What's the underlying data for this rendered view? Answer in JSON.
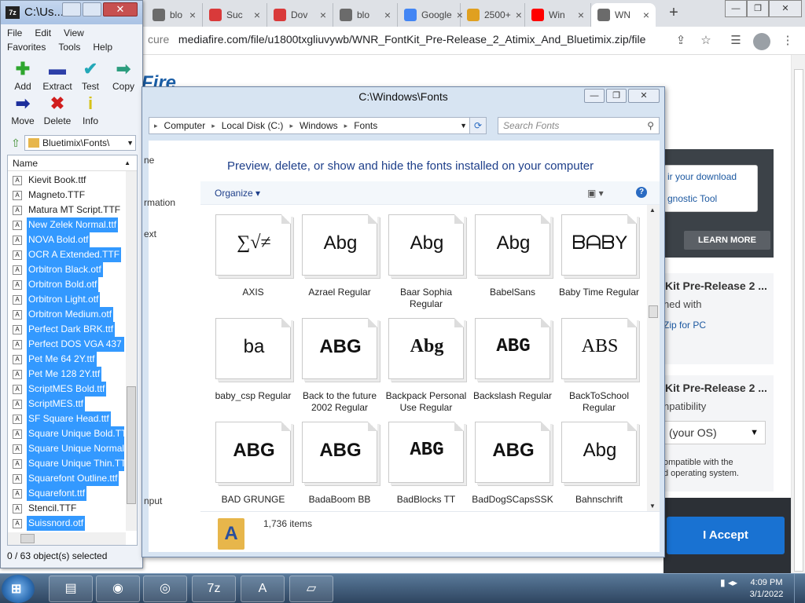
{
  "chrome": {
    "tabs": [
      {
        "label": "blo",
        "favicon_color": "#6b6b6b"
      },
      {
        "label": "Suc",
        "favicon_color": "#d93a3a"
      },
      {
        "label": "Dov",
        "favicon_color": "#d93a3a"
      },
      {
        "label": "blo",
        "favicon_color": "#6b6b6b"
      },
      {
        "label": "Google",
        "favicon_color": "#4285f4"
      },
      {
        "label": "2500+",
        "favicon_color": "#e0a020"
      },
      {
        "label": "Win",
        "favicon_color": "#ff0000"
      },
      {
        "label": "WN",
        "favicon_color": "#6b6b6b"
      }
    ],
    "tab_close": "×",
    "new_tab": "+",
    "url_scheme": "cure",
    "url": "mediafire.com/file/u1800txgliuvywb/WNR_FontKit_Pre-Release_2_Atimix_And_Bluetimix.zip/file"
  },
  "page": {
    "logo": "Fire",
    "download_links": [
      "ir your download",
      "gnostic Tool"
    ],
    "learn_more": "LEARN MORE",
    "card1": {
      "title": "Kit Pre-Release 2 ...",
      "sub": "ned with",
      "link": "Zip for PC"
    },
    "card2": {
      "title": "Kit Pre-Release 2 ...",
      "sub": "npatibility",
      "select": "(your OS)",
      "note1": "ompatible with the",
      "note2": "d operating system."
    },
    "accept": "I Accept",
    "accent": "#1972d2"
  },
  "sevenzip": {
    "title": "C:\\Us...",
    "menu_row1": [
      "File",
      "Edit",
      "View"
    ],
    "menu_row2": [
      "Favorites",
      "Tools",
      "Help"
    ],
    "toolbar": [
      {
        "label": "Add",
        "icon": "plus-icon",
        "glyph": "✚",
        "color": "#2ea62e"
      },
      {
        "label": "Extract",
        "icon": "minus-icon",
        "glyph": "▬",
        "color": "#2d3fa8"
      },
      {
        "label": "Test",
        "icon": "check-icon",
        "glyph": "✔",
        "color": "#23a8b8"
      },
      {
        "label": "Copy",
        "icon": "arrow-right-icon",
        "glyph": "➡",
        "color": "#2c9d7e"
      },
      {
        "label": "Move",
        "icon": "move-arrow-icon",
        "glyph": "➡",
        "color": "#1d2f9c"
      },
      {
        "label": "Delete",
        "icon": "x-icon",
        "glyph": "✖",
        "color": "#d11e1e"
      },
      {
        "label": "Info",
        "icon": "info-icon",
        "glyph": "i",
        "color": "#d6c21a"
      }
    ],
    "path": "Bluetimix\\Fonts\\",
    "column_name": "Name",
    "files": [
      {
        "name": "Kievit Book.ttf",
        "selected": false
      },
      {
        "name": "Magneto.TTF",
        "selected": false
      },
      {
        "name": "Matura MT Script.TTF",
        "selected": false
      },
      {
        "name": "New Zelek Normal.ttf",
        "selected": true
      },
      {
        "name": "NOVA Bold.otf",
        "selected": true
      },
      {
        "name": "OCR A Extended.TTF",
        "selected": true
      },
      {
        "name": "Orbitron Black.otf",
        "selected": true
      },
      {
        "name": "Orbitron Bold.otf",
        "selected": true
      },
      {
        "name": "Orbitron Light.otf",
        "selected": true
      },
      {
        "name": "Orbitron Medium.otf",
        "selected": true
      },
      {
        "name": "Perfect Dark BRK.ttf",
        "selected": true
      },
      {
        "name": "Perfect DOS VGA 437 W",
        "selected": true
      },
      {
        "name": "Pet Me 64 2Y.ttf",
        "selected": true
      },
      {
        "name": "Pet Me 128 2Y.ttf",
        "selected": true
      },
      {
        "name": "ScriptMES Bold.ttf",
        "selected": true
      },
      {
        "name": "ScriptMES.ttf",
        "selected": true
      },
      {
        "name": "SF Square Head.ttf",
        "selected": true
      },
      {
        "name": "Square Unique Bold.TTF",
        "selected": true
      },
      {
        "name": "Square Unique Normal.",
        "selected": true
      },
      {
        "name": "Square Unique Thin.TT",
        "selected": true
      },
      {
        "name": "Squarefont Outline.ttf",
        "selected": true
      },
      {
        "name": "Squarefont.ttf",
        "selected": true
      },
      {
        "name": "Stencil.TTF",
        "selected": false
      },
      {
        "name": "Suissnord.otf",
        "selected": true
      }
    ],
    "status": "0 / 63 object(s) selected"
  },
  "fonts_window": {
    "title": "C:\\Windows\\Fonts",
    "crumbs": [
      "Computer",
      "Local Disk (C:)",
      "Windows",
      "Fonts"
    ],
    "search_placeholder": "Search Fonts",
    "heading": "Preview, delete, or show and hide the fonts installed on your computer",
    "organize": "Organize",
    "nav": [
      "ne",
      "rmation",
      "ext",
      "nput"
    ],
    "fonts": [
      {
        "name": "AXIS",
        "sample": "∑√≠",
        "font": "serif",
        "weight": "normal"
      },
      {
        "name": "Azrael Regular",
        "sample": "Abg",
        "font": "sans",
        "weight": "normal"
      },
      {
        "name": "Baar Sophia Regular",
        "sample": "Abg",
        "font": "sans",
        "weight": "normal"
      },
      {
        "name": "BabelSans",
        "sample": "Abg",
        "font": "sans",
        "weight": "normal"
      },
      {
        "name": "Baby Time Regular",
        "sample": "ᗷᗩᗷY",
        "font": "sans",
        "weight": "normal"
      },
      {
        "name": "baby_csp Regular",
        "sample": "ba",
        "font": "sans",
        "weight": "normal"
      },
      {
        "name": "Back to the future 2002 Regular",
        "sample": "ABG",
        "font": "sans",
        "weight": "bold"
      },
      {
        "name": "Backpack Personal Use Regular",
        "sample": "Abg",
        "font": "serif",
        "weight": "bold"
      },
      {
        "name": "Backslash Regular",
        "sample": "ABG",
        "font": "mono",
        "weight": "bold"
      },
      {
        "name": "BackToSchool Regular",
        "sample": "ABS",
        "font": "serif",
        "weight": "normal"
      },
      {
        "name": "BAD GRUNGE",
        "sample": "ABG",
        "font": "sans",
        "weight": "bold"
      },
      {
        "name": "BadaBoom BB",
        "sample": "ABG",
        "font": "sans",
        "weight": "bold"
      },
      {
        "name": "BadBlocks TT",
        "sample": "ABG",
        "font": "mono",
        "weight": "bold"
      },
      {
        "name": "BadDogSCapsSSK",
        "sample": "ABG",
        "font": "sans",
        "weight": "bold"
      },
      {
        "name": "Bahnschrift",
        "sample": "Abg",
        "font": "sans",
        "weight": "normal"
      }
    ],
    "item_count": "1,736 items"
  },
  "taskbar": {
    "apps": [
      {
        "name": "file-explorer",
        "glyph": "▤"
      },
      {
        "name": "firefox",
        "glyph": "◉"
      },
      {
        "name": "chrome",
        "glyph": "◎"
      },
      {
        "name": "7zip",
        "glyph": "7z"
      },
      {
        "name": "font-viewer",
        "glyph": "A"
      },
      {
        "name": "notepad",
        "glyph": "▱"
      }
    ],
    "time": "4:09 PM",
    "date": "3/1/2022"
  }
}
